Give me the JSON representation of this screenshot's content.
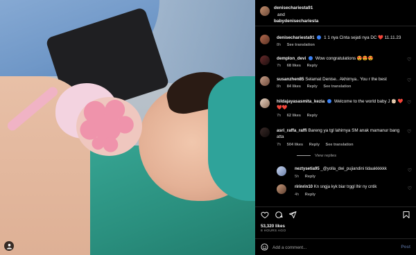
{
  "header": {
    "user1": "denisechariesta91",
    "and": "and",
    "user2": "babydenisechariesta"
  },
  "caption": {
    "username": "denisechariesta91",
    "text": "1 1 nya Cinta sejati nya DC ❤️  11.11.23",
    "time": "8h",
    "see_translation": "See translation"
  },
  "comments": [
    {
      "username": "demplon_devi",
      "text": "Wow congratulations 😍😍😍",
      "time": "7h",
      "likes": "68 likes",
      "reply": "Reply"
    },
    {
      "username": "susanzhen85",
      "text": "Selamat Denise.. Akhirnya.. You r the best",
      "time": "8h",
      "likes": "84 likes",
      "reply": "Reply",
      "see_translation": "See translation"
    },
    {
      "username": "hildajayasasmita_kezia",
      "text": "Welcome to the world baby J 👶🏻 ❤️❤️❤️",
      "time": "7h",
      "likes": "62 likes",
      "reply": "Reply"
    },
    {
      "username": "asri_raffa_raffi",
      "text": "Bareng ya tgl lahirnya SM anak mamanur bang atta",
      "time": "7h",
      "likes": "504 likes",
      "reply": "Reply",
      "see_translation": "See translation"
    }
  ],
  "view_replies": "View replies",
  "replies": [
    {
      "username": "neztysetia95",
      "text": "_@yolla_dwi_pujiandini tidaakkkkkk",
      "time": "5h",
      "reply": "Reply"
    },
    {
      "username": "ririnrin10",
      "text": "Kn sngja kyk biar trggl lhir ny cntik",
      "time": "4h",
      "reply": "Reply"
    }
  ],
  "likes": "53,320 likes",
  "time_ago": "8 HOURS AGO",
  "add_comment": {
    "placeholder": "Add a comment...",
    "post": "Post"
  },
  "colors": {
    "accent_blue": "#3b82f6",
    "heart_red": "#ff3040",
    "muted": "#a8a8a8",
    "post_disabled": "#4a5d83"
  },
  "icons": [
    "user-tag-icon",
    "heart-icon",
    "comment-icon",
    "share-icon",
    "bookmark-icon",
    "emoji-icon",
    "more-icon"
  ]
}
